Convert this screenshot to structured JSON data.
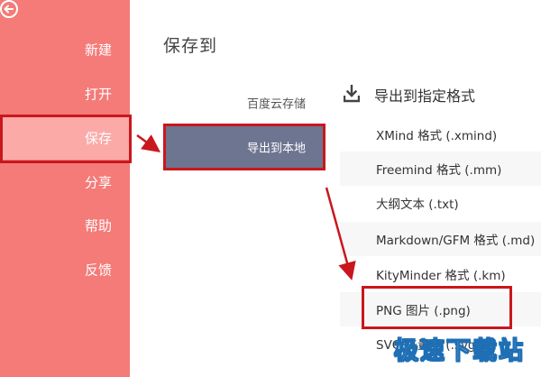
{
  "sidebar": {
    "items": [
      {
        "label": "新建"
      },
      {
        "label": "打开"
      },
      {
        "label": "保存"
      },
      {
        "label": "分享"
      },
      {
        "label": "帮助"
      },
      {
        "label": "反馈"
      }
    ]
  },
  "main": {
    "title": "保存到",
    "destinations": [
      {
        "label": "百度云存储"
      },
      {
        "label": "导出到本地"
      }
    ]
  },
  "export_panel": {
    "title": "导出到指定格式",
    "formats": [
      {
        "label": "XMind 格式 (.xmind)"
      },
      {
        "label": "Freemind 格式 (.mm)"
      },
      {
        "label": "大纲文本 (.txt)"
      },
      {
        "label": "Markdown/GFM 格式 (.md)"
      },
      {
        "label": "KityMinder 格式 (.km)"
      },
      {
        "label": "PNG 图片 (.png)"
      },
      {
        "label": "SVG 矢量图 (.svg)"
      }
    ]
  },
  "watermark": {
    "text": "极速下载站"
  },
  "colors": {
    "sidebar_bg": "#f47b78",
    "sidebar_active": "#fbaaa8",
    "selected_bg": "#6e7590",
    "annotation_red": "#c9171d"
  }
}
